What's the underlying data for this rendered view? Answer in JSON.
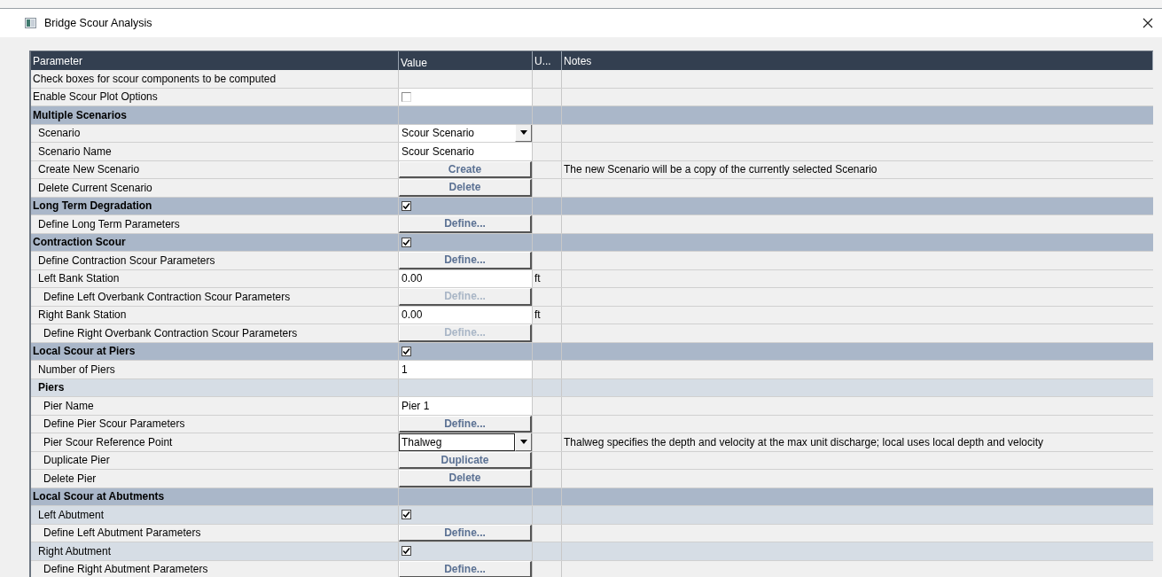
{
  "window": {
    "title": "Bridge Scour Analysis"
  },
  "table": {
    "columns": [
      "Parameter",
      "Value",
      "U...",
      "Notes"
    ],
    "rows": [
      {
        "label": "Check boxes for scour components to be computed",
        "kind": "item",
        "heading": false
      },
      {
        "label": "Enable Scour Plot Options",
        "kind": "item",
        "heading": false,
        "value": {
          "kind": "checkbox",
          "checked": false
        }
      },
      {
        "label": "Multiple Scenarios",
        "kind": "section",
        "heading": true,
        "children": [
          {
            "label": "Scenario",
            "kind": "item",
            "heading": false,
            "value": {
              "kind": "dropdown",
              "text": "Scour Scenario",
              "focused": false
            }
          },
          {
            "label": "Scenario Name",
            "kind": "item",
            "heading": false,
            "value": {
              "kind": "input",
              "text": "Scour Scenario"
            }
          },
          {
            "label": "Create New Scenario",
            "kind": "item",
            "heading": false,
            "value": {
              "kind": "button",
              "text": "Create",
              "disabled": false
            },
            "note": "The new Scenario will be a copy of the currently selected Scenario"
          },
          {
            "label": "Delete Current Scenario",
            "kind": "item",
            "heading": false,
            "value": {
              "kind": "button",
              "text": "Delete",
              "disabled": false
            }
          }
        ]
      },
      {
        "label": "Long Term Degradation",
        "kind": "section",
        "heading": true,
        "value": {
          "kind": "checkbox",
          "checked": true
        },
        "children": [
          {
            "label": "Define Long Term Parameters",
            "kind": "item",
            "heading": false,
            "value": {
              "kind": "button",
              "text": "Define...",
              "disabled": false
            }
          }
        ]
      },
      {
        "label": "Contraction Scour",
        "kind": "section",
        "heading": true,
        "value": {
          "kind": "checkbox",
          "checked": true
        },
        "children": [
          {
            "label": "Define Contraction Scour Parameters",
            "kind": "item",
            "heading": false,
            "value": {
              "kind": "button",
              "text": "Define...",
              "disabled": false
            }
          },
          {
            "label": "Left Bank Station",
            "kind": "item",
            "heading": false,
            "value": {
              "kind": "input",
              "text": "0.00"
            },
            "unit": "ft",
            "children": [
              {
                "label": "Define Left Overbank Contraction Scour Parameters",
                "kind": "item",
                "heading": false,
                "value": {
                  "kind": "button",
                  "text": "Define...",
                  "disabled": true
                }
              }
            ]
          },
          {
            "label": "Right Bank Station",
            "kind": "item",
            "heading": false,
            "value": {
              "kind": "input",
              "text": "0.00"
            },
            "unit": "ft",
            "children": [
              {
                "label": "Define Right Overbank Contraction Scour Parameters",
                "kind": "item",
                "heading": false,
                "value": {
                  "kind": "button",
                  "text": "Define...",
                  "disabled": true
                }
              }
            ]
          }
        ]
      },
      {
        "label": "Local Scour at Piers",
        "kind": "section",
        "heading": true,
        "value": {
          "kind": "checkbox",
          "checked": true
        },
        "children": [
          {
            "label": "Number of Piers",
            "kind": "item",
            "heading": false,
            "value": {
              "kind": "input",
              "text": "1"
            }
          },
          {
            "label": "Piers",
            "kind": "group",
            "heading": true,
            "children": [
              {
                "label": "Pier Name",
                "kind": "item",
                "heading": false,
                "value": {
                  "kind": "input",
                  "text": "Pier 1"
                }
              },
              {
                "label": "Define Pier Scour Parameters",
                "kind": "item",
                "heading": false,
                "value": {
                  "kind": "button",
                  "text": "Define...",
                  "disabled": false
                }
              },
              {
                "label": "Pier Scour Reference Point",
                "kind": "item",
                "heading": false,
                "value": {
                  "kind": "dropdown",
                  "text": "Thalweg",
                  "focused": true
                },
                "note": "Thalweg specifies the depth and velocity at the max unit discharge; local uses local depth and velocity"
              },
              {
                "label": "Duplicate Pier",
                "kind": "item",
                "heading": false,
                "value": {
                  "kind": "button",
                  "text": "Duplicate",
                  "disabled": false
                }
              },
              {
                "label": "Delete Pier",
                "kind": "item",
                "heading": false,
                "value": {
                  "kind": "button",
                  "text": "Delete",
                  "disabled": false
                }
              }
            ]
          }
        ]
      },
      {
        "label": "Local Scour at Abutments",
        "kind": "section",
        "heading": true,
        "children": [
          {
            "label": "Left Abutment",
            "kind": "group",
            "heading": false,
            "value": {
              "kind": "checkbox",
              "checked": true
            },
            "children": [
              {
                "label": "Define Left Abutment Parameters",
                "kind": "item",
                "heading": false,
                "value": {
                  "kind": "button",
                  "text": "Define...",
                  "disabled": false
                }
              }
            ]
          },
          {
            "label": "Right Abutment",
            "kind": "group",
            "heading": false,
            "value": {
              "kind": "checkbox",
              "checked": true
            },
            "children": [
              {
                "label": "Define Right Abutment Parameters",
                "kind": "item",
                "heading": false,
                "value": {
                  "kind": "button",
                  "text": "Define...",
                  "disabled": false
                }
              }
            ]
          }
        ]
      }
    ]
  }
}
